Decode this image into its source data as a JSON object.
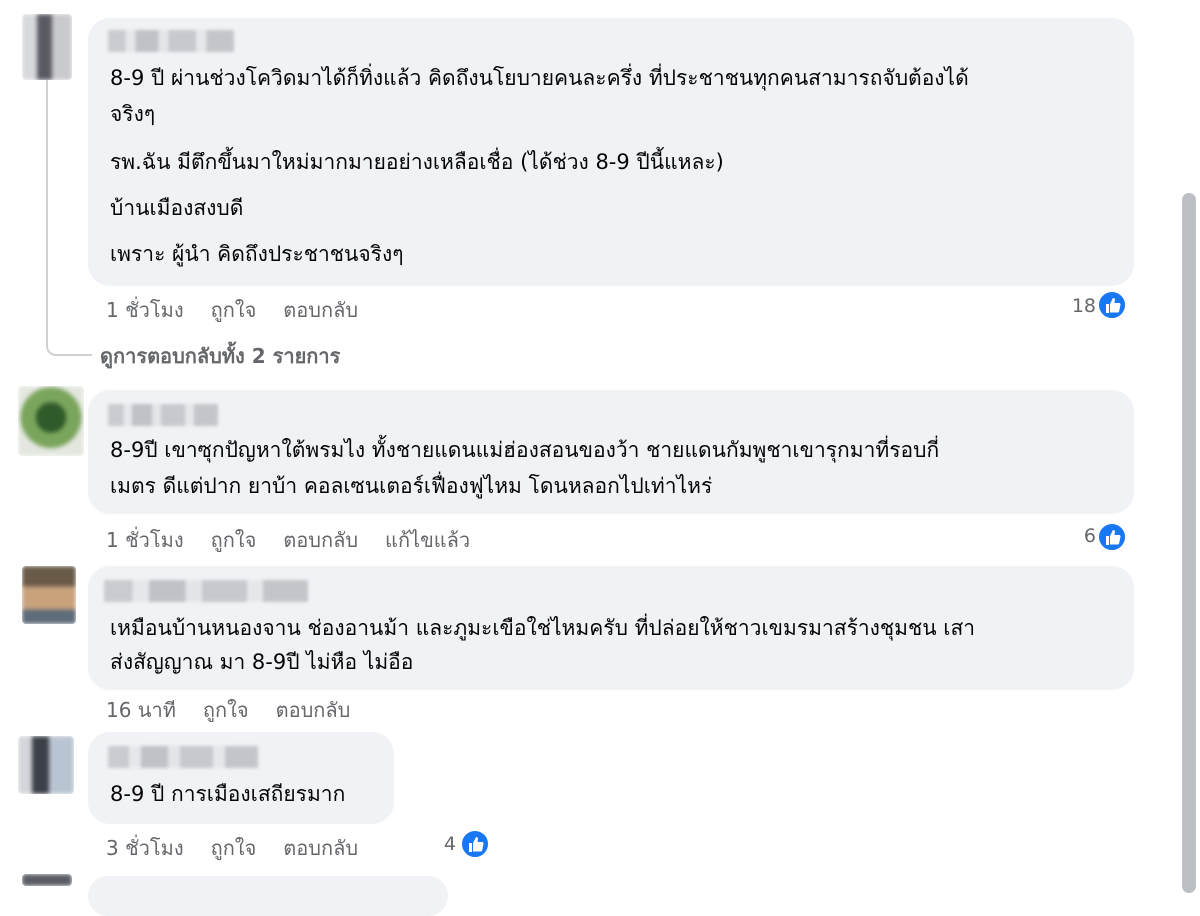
{
  "comments": [
    {
      "author": "",
      "lines": [
        "8-9 ปี ผ่านช่วงโควิดมาได้ก็ทิ่งแล้ว คิดถึงนโยบายคนละครึ่ง ที่ประชาชนทุกคนสามารถจับต้องได้",
        "จริงๆ",
        "รพ.ฉัน มีตึกขึ้นมาใหม่มากมายอย่างเหลือเชื่อ (ได้ช่วง 8-9 ปีนี้แหละ)",
        "บ้านเมืองสงบดี",
        "เพราะ ผู้นำ คิดถึงประชาชนจริงๆ"
      ],
      "time": "1 ชั่วโมง",
      "like_label": "ถูกใจ",
      "reply_label": "ตอบกลับ",
      "reaction_count": "18",
      "view_replies": "ดูการตอบกลับทั้ง 2 รายการ"
    },
    {
      "author": "",
      "lines": [
        "8-9ปี เขาซุกปัญหาใต้พรมไง ทั้งชายแดนแม่ฮ่องสอนของว้า ชายแดนกัมพูชาเขารุกมาที่รอบกี่",
        "เมตร ดีแต่ปาก ยาบ้า คอลเซนเตอร์เฟื่องฟูไหม โดนหลอกไปเท่าไหร่"
      ],
      "time": "1 ชั่วโมง",
      "like_label": "ถูกใจ",
      "reply_label": "ตอบกลับ",
      "edited_label": "แก้ไขแล้ว",
      "reaction_count": "6"
    },
    {
      "author": "",
      "lines": [
        "เหมือนบ้านหนองจาน ช่องอานม้า และภูมะเขือใช่ไหมครับ ที่ปล่อยให้ชาวเขมรมาสร้างชุมชน เสา",
        "ส่งสัญญาณ มา 8-9ปี ไม่หือ ไม่อือ"
      ],
      "time": "16 นาที",
      "like_label": "ถูกใจ",
      "reply_label": "ตอบกลับ"
    },
    {
      "author": "",
      "lines": [
        "8-9 ปี การเมืองเสถียรมาก"
      ],
      "time": "3 ชั่วโมง",
      "like_label": "ถูกใจ",
      "reply_label": "ตอบกลับ",
      "reaction_count": "4"
    }
  ],
  "colors": {
    "bubble": "#f0f2f5",
    "meta_text": "#65676b",
    "like_blue": "#1877f2",
    "thread_line": "#ced0d4"
  },
  "icons": {
    "reaction": "like-thumb-icon"
  }
}
